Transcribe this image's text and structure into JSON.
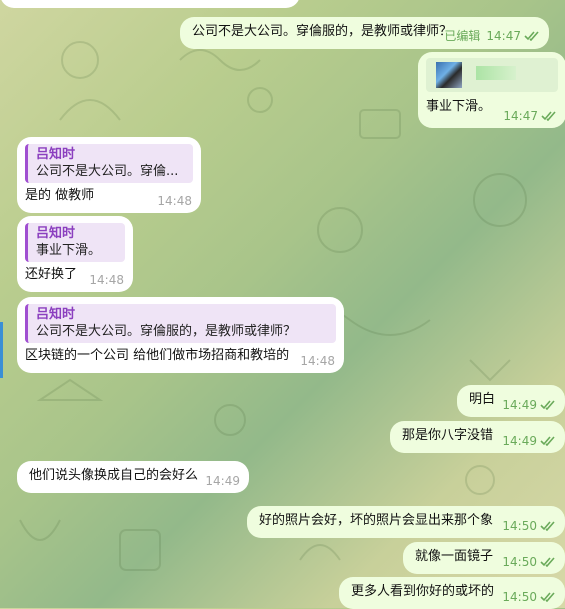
{
  "colors": {
    "incoming_bg": "#ffffff",
    "outgoing_bg": "#effdde",
    "sender_name": "#8b3fbf",
    "time_out": "#6aaa5a",
    "time_in": "#a6a6a6"
  },
  "messages": [
    {
      "id": "m1",
      "dir": "out",
      "text": "公司不是大公司。穿倫服的，是教师或律师？",
      "edited": "已编辑",
      "time": "14:47"
    },
    {
      "id": "m2",
      "dir": "out",
      "text": "事业下滑。",
      "time": "14:47",
      "has_image": true
    },
    {
      "id": "m3",
      "dir": "in",
      "reply_name": "吕知时",
      "reply_text": "公司不是大公司。穿倫...",
      "text": "是的 做教师",
      "time": "14:48"
    },
    {
      "id": "m4",
      "dir": "in",
      "reply_name": "吕知时",
      "reply_text": "事业下滑。",
      "text": "还好换了",
      "time": "14:48"
    },
    {
      "id": "m5",
      "dir": "in",
      "reply_name": "吕知时",
      "reply_text": "公司不是大公司。穿倫服的，是教师或律师？",
      "text": "区块链的一个公司 给他们做市场招商和教培的",
      "time": "14:48"
    },
    {
      "id": "m6",
      "dir": "out",
      "text": "明白",
      "time": "14:49"
    },
    {
      "id": "m7",
      "dir": "out",
      "text": "那是你八字没错",
      "time": "14:49"
    },
    {
      "id": "m8",
      "dir": "in",
      "text": "他们说头像换成自己的会好么",
      "time": "14:49"
    },
    {
      "id": "m9",
      "dir": "out",
      "text": "好的照片会好，坏的照片会显出来那个象",
      "time": "14:50"
    },
    {
      "id": "m10",
      "dir": "out",
      "text": "就像一面镜子",
      "time": "14:50"
    },
    {
      "id": "m11",
      "dir": "out",
      "text": "更多人看到你好的或坏的",
      "time": "14:50"
    }
  ]
}
